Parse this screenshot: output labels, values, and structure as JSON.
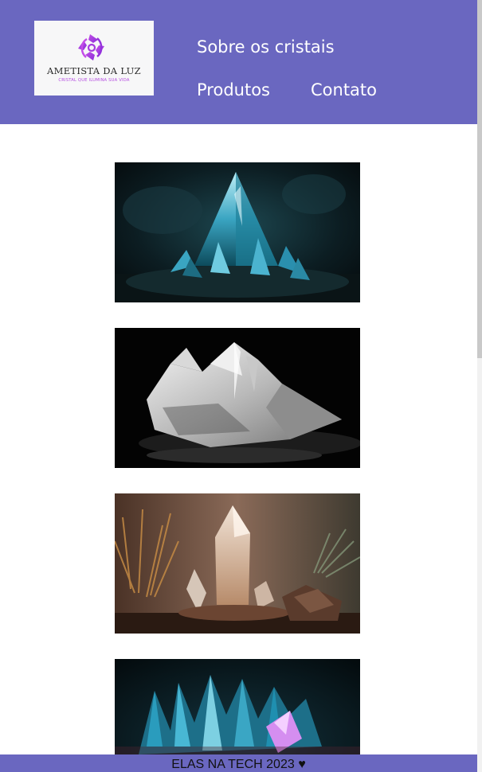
{
  "brand": {
    "name": "AMETISTA DA LUZ",
    "tagline": "CRISTAL QUE ILUMINA SUA VIDA",
    "logo_icon": "amethyst-spiral-logo",
    "logo_color": "#b44ce0"
  },
  "nav": {
    "about": "Sobre os cristais",
    "products": "Produtos",
    "contact": "Contato"
  },
  "gallery": [
    {
      "name": "blue-crystal-pyramid-image"
    },
    {
      "name": "clear-quartz-point-image"
    },
    {
      "name": "quartz-tower-warm-light-image"
    },
    {
      "name": "blue-crystal-cluster-image"
    }
  ],
  "footer": {
    "text": "ELAS NA TECH 2023 ♥"
  },
  "colors": {
    "header_bg": "#6a67c0",
    "footer_bg": "#6a67c0",
    "nav_text": "#ffffff",
    "page_bg": "#ffffff"
  }
}
